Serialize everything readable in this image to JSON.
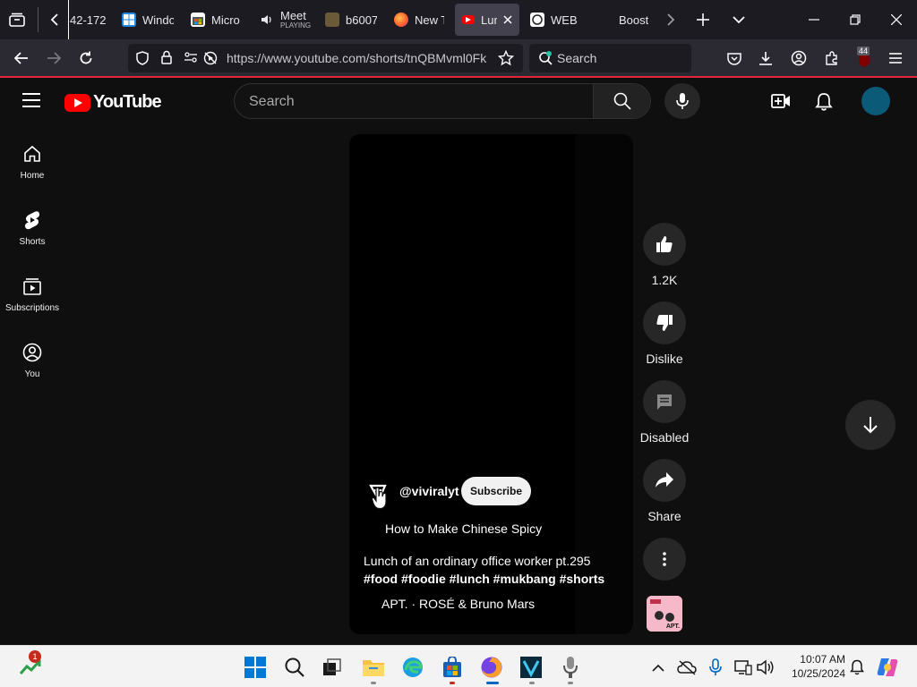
{
  "browser": {
    "tabs": [
      {
        "label": "42-172",
        "icon": "page-icon"
      },
      {
        "label": "Windo",
        "icon": "windows-icon"
      },
      {
        "label": "Micro",
        "icon": "store-icon"
      },
      {
        "label": "Meet",
        "sublabel": "PLAYING",
        "icon": "speaker-icon"
      },
      {
        "label": "b6007",
        "icon": "page-icon"
      },
      {
        "label": "New T",
        "icon": "firefox-icon"
      },
      {
        "label": "Lun",
        "icon": "youtube-icon",
        "active": true
      },
      {
        "label": "WEB",
        "icon": "page-icon"
      },
      {
        "label": "Boost",
        "icon": "page-icon"
      }
    ],
    "url": "https://www.youtube.com/shorts/tnQBMvml0Fk",
    "search_placeholder": "Search",
    "extension_badge": "44"
  },
  "youtube": {
    "logo_text": "YouTube",
    "search_placeholder": "Search",
    "sidebar": [
      {
        "label": "Home",
        "icon": "home-icon"
      },
      {
        "label": "Shorts",
        "icon": "shorts-icon"
      },
      {
        "label": "Subscriptions",
        "icon": "subscriptions-icon"
      },
      {
        "label": "You",
        "icon": "you-icon"
      }
    ],
    "short": {
      "channel": "@viviralyt",
      "subscribe_label": "Subscribe",
      "title_line1": "How to Make Chinese Spicy",
      "title_line2": "Lunch of an ordinary office worker pt.295",
      "hashtags": "#food #foodie #lunch #mukbang #shorts",
      "music": "APT. · ROSÉ & Bruno Mars",
      "music_thumb_text": "APT."
    },
    "actions": {
      "like_count": "1.2K",
      "dislike_label": "Dislike",
      "comments_label": "Disabled",
      "share_label": "Share"
    }
  },
  "taskbar": {
    "widget_badge": "1",
    "time": "10:07 AM",
    "date": "10/25/2024"
  },
  "colors": {
    "yt_red": "#ff0000",
    "firefox_accent": "#e0263c",
    "avatar": "#0b5a78"
  }
}
